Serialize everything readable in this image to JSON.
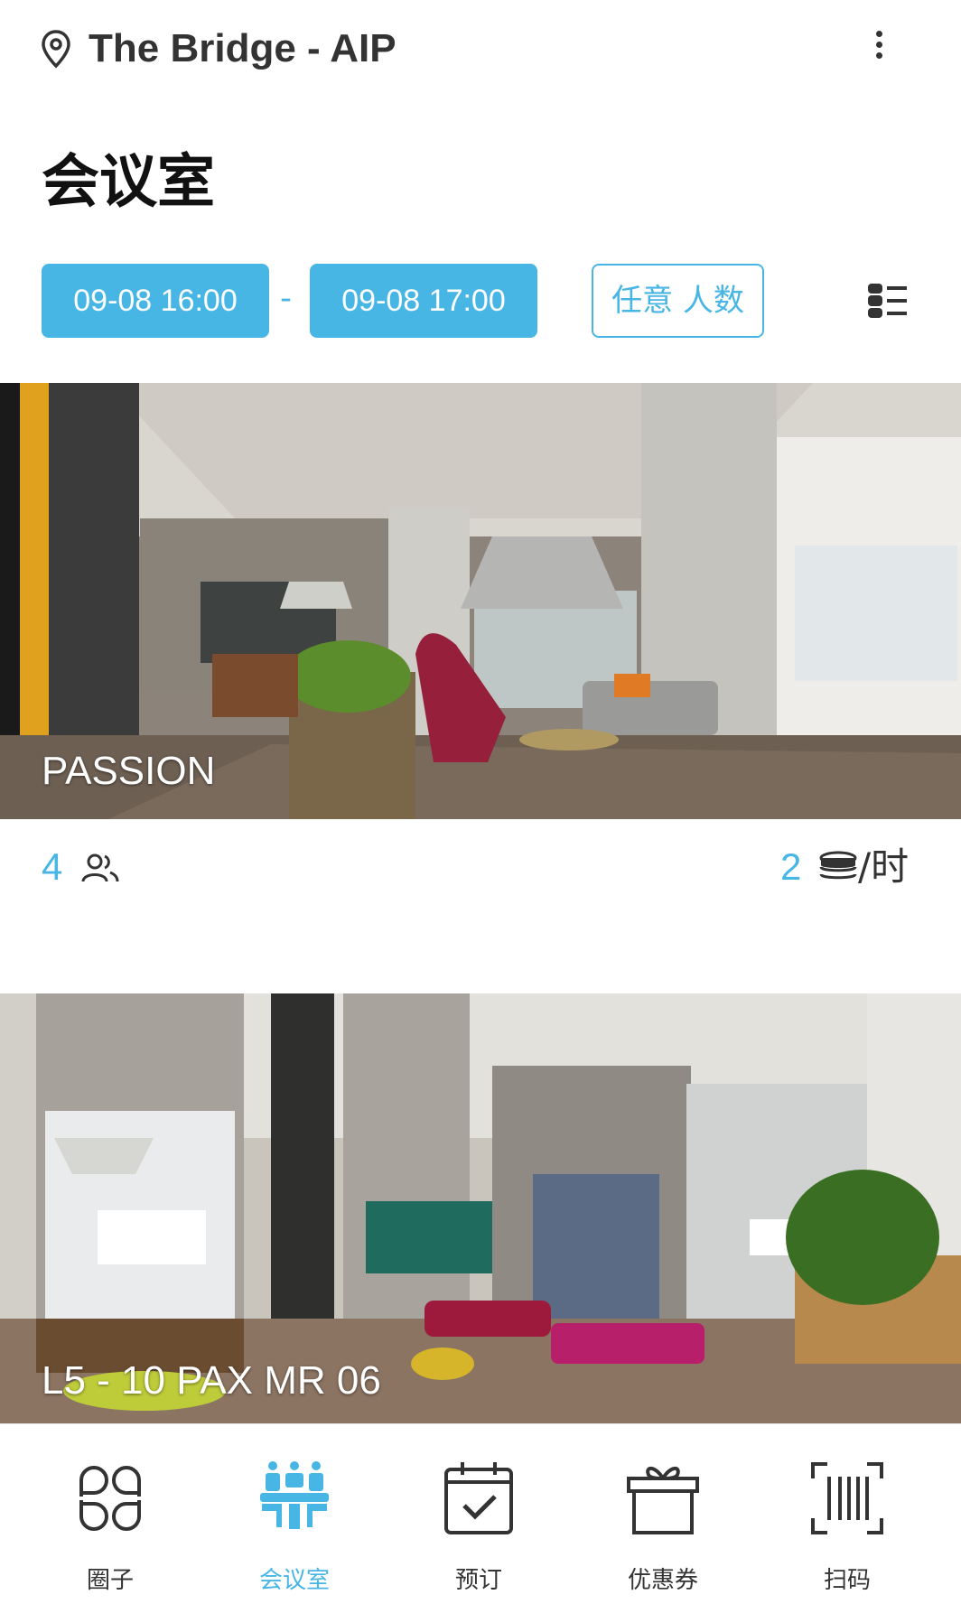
{
  "header": {
    "venue": "The Bridge - AIP",
    "location_icon": "location-pin-icon",
    "more_icon": "more-vertical-icon"
  },
  "page_title": "会议室",
  "filters": {
    "start_time": "09-08 16:00",
    "separator": "-",
    "end_time": "09-08 17:00",
    "capacity": "任意 人数",
    "view_toggle_icon": "list-view-icon"
  },
  "rooms": [
    {
      "name": "PASSION",
      "capacity": "4",
      "price": "2",
      "price_unit": "/时"
    },
    {
      "name": "L5 - 10 PAX MR 06"
    }
  ],
  "tabbar": {
    "items": [
      {
        "label": "圈子",
        "icon": "circles-icon",
        "active": false
      },
      {
        "label": "会议室",
        "icon": "meeting-room-icon",
        "active": true
      },
      {
        "label": "预订",
        "icon": "calendar-check-icon",
        "active": false
      },
      {
        "label": "优惠券",
        "icon": "gift-icon",
        "active": false
      },
      {
        "label": "扫码",
        "icon": "scan-barcode-icon",
        "active": false
      }
    ]
  },
  "colors": {
    "accent": "#47b6e5",
    "text": "#333333"
  }
}
